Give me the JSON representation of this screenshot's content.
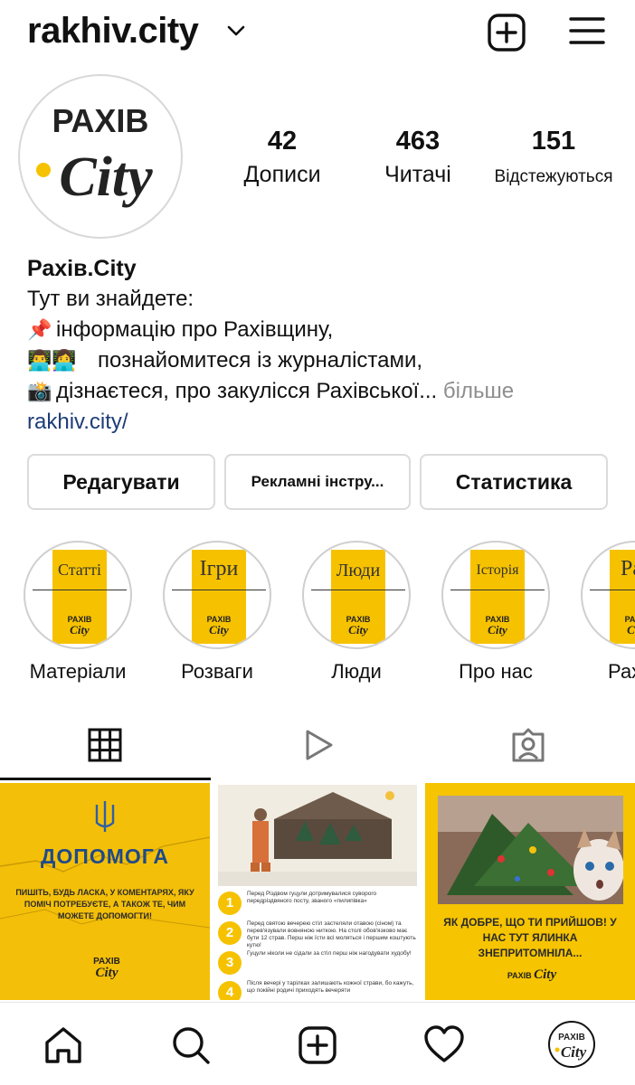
{
  "header": {
    "username": "rakhiv.city"
  },
  "profile": {
    "avatar_logo_top": "РАХІВ",
    "avatar_logo_bottom": "City",
    "stats": [
      {
        "value": "42",
        "label": "Дописи"
      },
      {
        "value": "463",
        "label": "Читачі"
      },
      {
        "value": "151",
        "label": "Відстежуються"
      }
    ],
    "display_name": "Рахів.City",
    "bio_lines": [
      {
        "emoji": "",
        "text": "Тут ви знайдете:"
      },
      {
        "emoji": "📌",
        "text": "інформацію про Рахівщину,"
      },
      {
        "emoji": "👨‍💻👩‍💻",
        "text": "познайомитеся із журналістами,"
      },
      {
        "emoji": "📸",
        "text": "дізнаєтеся, про закулісся Рахівської..."
      }
    ],
    "more_label": "більше",
    "link": "rakhiv.city/"
  },
  "actions": {
    "edit_label": "Редагувати",
    "promo_label": "Рекламні інстру...",
    "stats_label": "Статистика"
  },
  "highlights": [
    {
      "cover_word": "Статті",
      "caption": "Матеріали"
    },
    {
      "cover_word": "Ігри",
      "caption": "Розваги"
    },
    {
      "cover_word": "Люди",
      "caption": "Люди"
    },
    {
      "cover_word": "Історія",
      "caption": "Про нас"
    },
    {
      "cover_word": "Рах",
      "caption": "Рах"
    }
  ],
  "posts": {
    "post1": {
      "heading": "ДОПОМОГА",
      "body": "ПИШІТЬ, БУДЬ ЛАСКА, У КОМЕНТАРЯХ, ЯКУ ПОМІЧ ПОТРЕБУЄТЕ, А ТАКОЖ ТЕ, ЧИМ МОЖЕТЕ ДОПОМОГТИ!",
      "logo_top": "РАХІВ",
      "logo_bottom": "City"
    },
    "post2": {
      "items": [
        {
          "n": "1",
          "text": "Перед Різдвом гуцули дотримувалися суворого передріздвяного посту, званого «пилипівка»"
        },
        {
          "n": "2",
          "text": "Перед святою вечерею стіл застеляли отавою (сіном) та перев'язували вовняною ниткою. На столі обов'язково має бути 12 страв. Перш ніж їсти всі моляться і першим коштують кутю!"
        },
        {
          "n": "3",
          "text": "Гуцули ніколи не сідали за стіл перш ніж нагодувати худобу!"
        },
        {
          "n": "4",
          "text": "Після вечері у тарілках залишають кожної страви, бо кажуть, що покійні родичі приходять вечеряти"
        }
      ]
    },
    "post3": {
      "message": "ЯК ДОБРЕ, ЩО ТИ ПРИЙШОВ! У НАС ТУТ ЯЛИНКА ЗНЕПРИТОМНІЛА...",
      "logo_top": "РАХІВ",
      "logo_bottom": "City"
    }
  },
  "colors": {
    "accent_yellow": "#f6c200",
    "link_blue": "#1d3c78",
    "muted": "#8e8e8e"
  },
  "icons": {
    "top": [
      "chevron-down-icon",
      "new-post-icon",
      "menu-icon"
    ],
    "tabs": [
      "grid-icon",
      "reels-icon",
      "tagged-icon"
    ],
    "nav": [
      "home-icon",
      "search-icon",
      "new-post-icon",
      "heart-icon",
      "profile-avatar"
    ]
  }
}
